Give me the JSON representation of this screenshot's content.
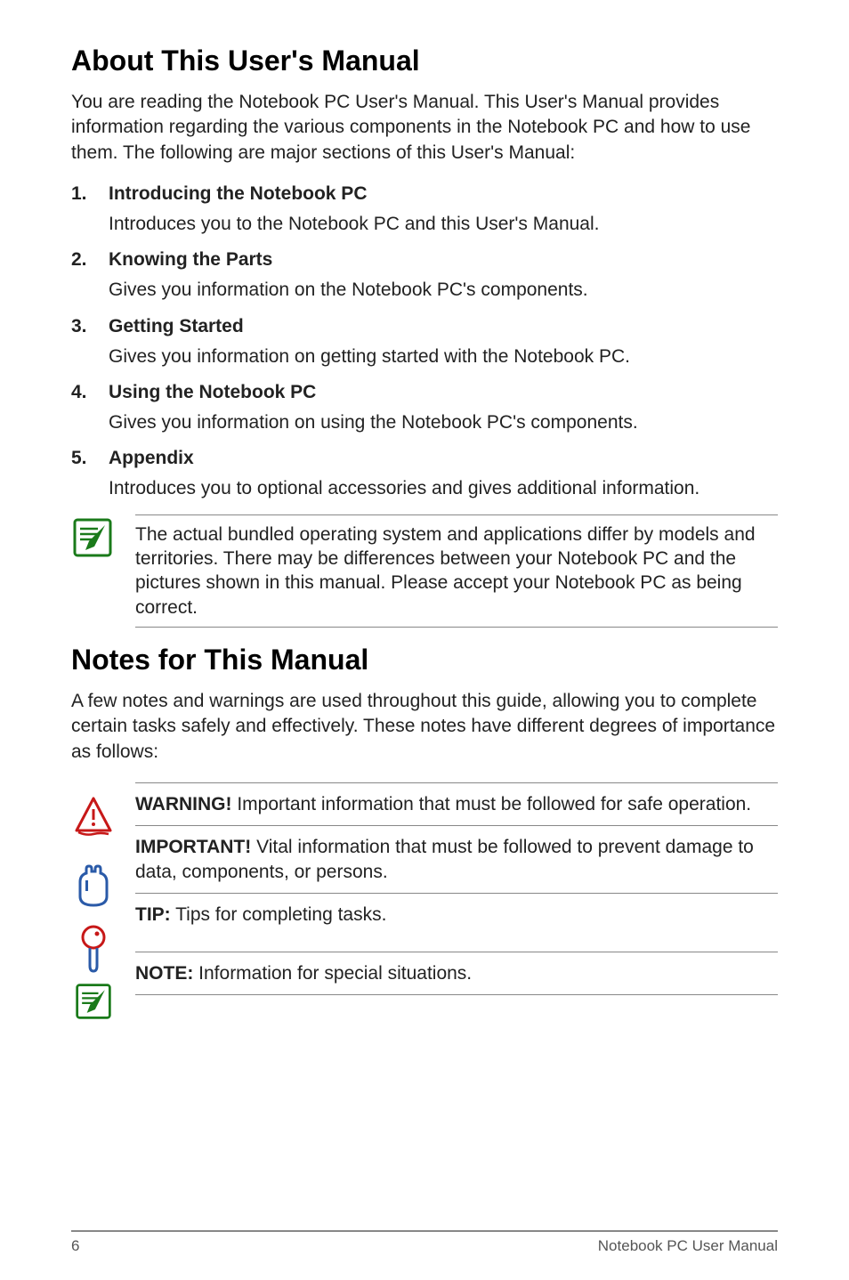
{
  "heading1": "About This User's Manual",
  "intro1": "You are reading the Notebook PC User's Manual. This User's Manual provides information regarding the various components in the Notebook PC and how to use them. The following are major sections of this User's Manual:",
  "sections": [
    {
      "num": "1.",
      "title": "Introducing the Notebook PC",
      "desc": "Introduces you to the Notebook PC and this User's Manual."
    },
    {
      "num": "2.",
      "title": "Knowing the Parts",
      "desc": "Gives you information on the Notebook PC's components."
    },
    {
      "num": "3.",
      "title": "Getting Started",
      "desc": "Gives you information on getting started with the Notebook PC."
    },
    {
      "num": "4.",
      "title": "Using the Notebook PC",
      "desc": "Gives you information on using the Notebook PC's components."
    },
    {
      "num": "5.",
      "title": "Appendix",
      "desc": "Introduces you to optional accessories and gives additional information."
    }
  ],
  "note1": "The actual bundled operating system and applications differ by models and territories. There may be differences between your Notebook PC and the pictures shown in this manual. Please accept your Notebook PC as being correct.",
  "heading2": "Notes for This Manual",
  "intro2": "A few notes and warnings are used throughout this guide, allowing you to complete certain tasks safely and effectively. These notes have different degrees of importance as follows:",
  "callouts": [
    {
      "label": "WARNING!",
      "text": " Important information that must be followed for safe operation."
    },
    {
      "label": "IMPORTANT!",
      "text": " Vital information that must be followed to prevent damage to data, components, or persons."
    },
    {
      "label": "TIP:",
      "text": " Tips for completing tasks."
    },
    {
      "label": "NOTE:",
      "text": "  Information for special situations."
    }
  ],
  "footer": {
    "page": "6",
    "title": "Notebook PC User Manual"
  }
}
